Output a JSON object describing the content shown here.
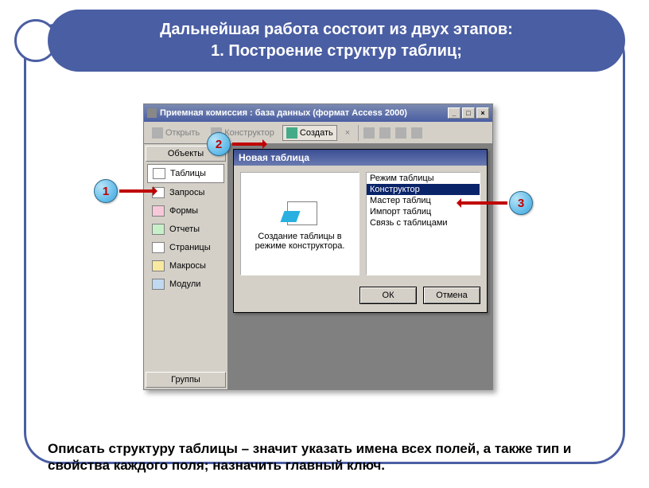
{
  "title": {
    "line1": "Дальнейшая работа состоит из двух этапов:",
    "line2": "1. Построение структур таблиц;"
  },
  "callouts": {
    "c1": "1",
    "c2": "2",
    "c3": "3"
  },
  "access_window": {
    "title": "Приемная комиссия : база данных (формат Access 2000)",
    "sys": {
      "min": "_",
      "max": "□",
      "close": "×"
    },
    "toolbar": {
      "open": "Открыть",
      "design": "Конструктор",
      "create": "Создать",
      "delete": "×"
    },
    "sidebar": {
      "header_objects": "Объекты",
      "items": [
        {
          "label": "Таблицы",
          "icon": "tables",
          "selected": true
        },
        {
          "label": "Запросы",
          "icon": "queries"
        },
        {
          "label": "Формы",
          "icon": "forms"
        },
        {
          "label": "Отчеты",
          "icon": "reports"
        },
        {
          "label": "Страницы",
          "icon": "pages"
        },
        {
          "label": "Макросы",
          "icon": "macros"
        },
        {
          "label": "Модули",
          "icon": "modules"
        }
      ],
      "header_groups": "Группы"
    },
    "dialog": {
      "title": "Новая таблица",
      "description": "Создание таблицы в режиме конструктора.",
      "options": [
        "Режим таблицы",
        "Конструктор",
        "Мастер таблиц",
        "Импорт таблиц",
        "Связь с таблицами"
      ],
      "selected_index": 1,
      "ok": "ОК",
      "cancel": "Отмена"
    }
  },
  "caption": "Описать структуру таблицы – значит указать имена всех полей, а также тип и свойства каждого поля; назначить главный ключ."
}
